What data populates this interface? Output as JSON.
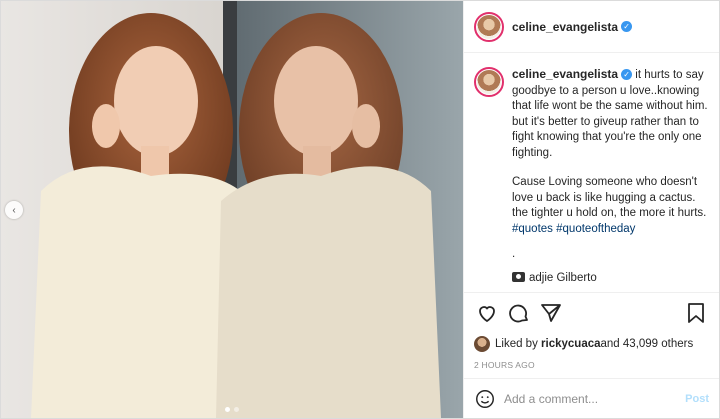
{
  "user": {
    "username": "celine_evangelista",
    "verified": true
  },
  "caption": {
    "username": "celine_evangelista",
    "text1": " it hurts to say goodbye to a person u love..knowing that life wont be the same without him. but it's better to giveup rather than to fight knowing that you're the only one fighting.",
    "text2": "Cause Loving someone who doesn't love u back is like hugging a cactus. the tighter u hold on, the more it hurts. ",
    "tag1": "#quotes",
    "tag2": "#quoteoftheday",
    "dot": ".",
    "credit": "adjie Gilberto",
    "time": "2h"
  },
  "likes": {
    "prefix": "Liked by ",
    "user": "rickycuaca",
    "suffix": " and 43,099 others"
  },
  "posted": "2 HOURS AGO",
  "comment": {
    "placeholder": "Add a comment...",
    "post_label": "Post"
  },
  "carousel": {
    "prev_icon": "‹",
    "slide_count": 2,
    "active_index": 0
  },
  "colors": {
    "accent": "#3897f0",
    "story_ring": "#e1306c",
    "tag": "#00376b"
  }
}
